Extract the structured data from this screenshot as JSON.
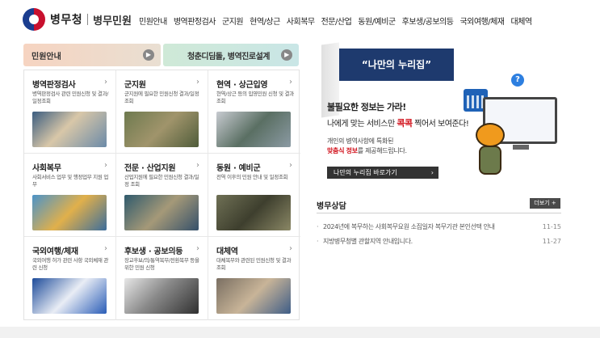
{
  "logo": {
    "text": "병무청",
    "sub": "병무민원"
  },
  "gnb": [
    "민원안내",
    "병역판정검사",
    "군지원",
    "현역/상근",
    "사회복무",
    "전문/산업",
    "동원/예비군",
    "후보생/공보의등",
    "국외여행/체재",
    "대체역"
  ],
  "banners": {
    "civil": "민원안내",
    "youth": "청춘디딤돌, 병역진로설계",
    "arrow_icon": "circle-arrow-right-icon"
  },
  "services": [
    {
      "title": "병역판정검사",
      "desc": "병역판정검사 관련 민원신청 및 결과/일정조회"
    },
    {
      "title": "군지원",
      "desc": "군지원에 필요한 민원신청 결과/일정 조회"
    },
    {
      "title": "현역 · 상근입영",
      "desc": "현역/상근 등의 입영민원 신청 및 결과 조회"
    },
    {
      "title": "사회복무",
      "desc": "사회서비스 업무 및 행정업무 지원 업무"
    },
    {
      "title": "전문 · 산업지원",
      "desc": "산업지원에 필요한 민원신청 결과/일정 조회"
    },
    {
      "title": "동원 · 예비군",
      "desc": "전역 이후의 민원 안내 및 일정조회"
    },
    {
      "title": "국외여행/체재",
      "desc": "국외여행 허가 관련 사항 국외체재 관련 신청"
    },
    {
      "title": "후보생 · 공보의등",
      "desc": "장교후보/의/통역복무/전환복무 등을 위한 민원 신청"
    },
    {
      "title": "대체역",
      "desc": "대체복무와 관련된 민원신청 및 결과 조회"
    }
  ],
  "promo": {
    "ribbon": "“나만의 누리집”",
    "line1": "불필요한 정보는 가라!",
    "line2_pre": "나에게 맞는 서비스만 ",
    "line2_hl": "콕콕",
    "line2_post": " 찍어서 보여준다!",
    "line3": "개인의 병역사항에 특화된",
    "line4_hl": "맞춤식 정보",
    "line4_post": "를 제공해드립니다.",
    "button": "나만의 누리집 바로가기",
    "help_icon": "?"
  },
  "consult": {
    "title": "병무상담",
    "more": "더보기 +",
    "items": [
      {
        "text": "2024년에 복무하는 사회복무요원 소집일자 복무기관 본인선택 안내",
        "date": "11-15"
      },
      {
        "text": "지방병무청별 관할지역 안내입니다.",
        "date": "11-27"
      }
    ]
  },
  "colors": {
    "navy": "#1e3a6e",
    "accent_red": "#d2141e",
    "button_dark": "#333333"
  }
}
